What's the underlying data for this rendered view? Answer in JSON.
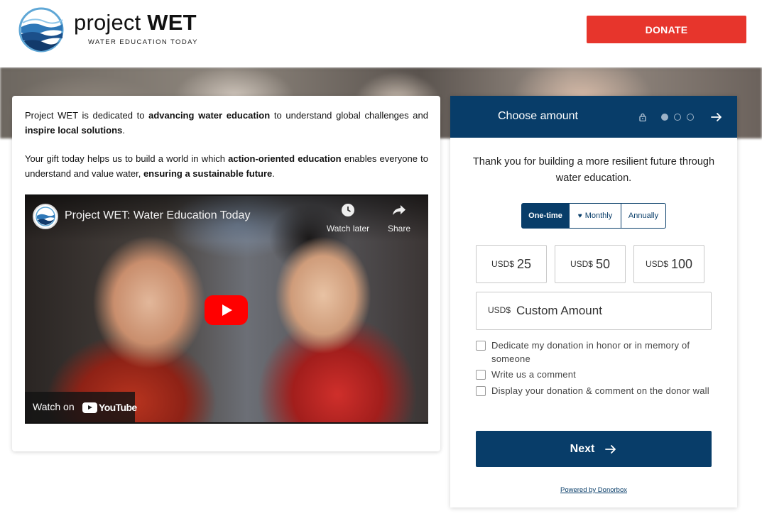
{
  "header": {
    "brand_light": "project",
    "brand_bold": "WET",
    "tagline": "WATER EDUCATION TODAY",
    "donate_label": "DONATE"
  },
  "info": {
    "p1": [
      {
        "text": "Project WET is dedicated to ",
        "bold": false
      },
      {
        "text": "advancing water education",
        "bold": true
      },
      {
        "text": " to understand global challenges and ",
        "bold": false
      },
      {
        "text": "inspire local solutions",
        "bold": true
      },
      {
        "text": ".",
        "bold": false
      }
    ],
    "p2": [
      {
        "text": "Your gift today helps us to build a world in which ",
        "bold": false
      },
      {
        "text": "action-oriented education",
        "bold": true
      },
      {
        "text": " enables everyone to understand and value water, ",
        "bold": false
      },
      {
        "text": "ensuring a sustainable future",
        "bold": true
      },
      {
        "text": ".",
        "bold": false
      }
    ]
  },
  "video": {
    "title": "Project WET: Water Education Today",
    "watch_later": "Watch later",
    "share": "Share",
    "watch_on": "Watch on",
    "youtube": "YouTube"
  },
  "donation": {
    "step_title": "Choose amount",
    "step_count": 3,
    "step_current": 1,
    "thanks": "Thank you for building a more resilient future through water education.",
    "frequencies": [
      "One-time",
      "Monthly",
      "Annually"
    ],
    "frequency_selected": "One-time",
    "currency": "USD$",
    "amounts": [
      "25",
      "50",
      "100"
    ],
    "custom_placeholder": "Custom Amount",
    "options": [
      "Dedicate my donation in honor or in memory of someone",
      "Write us a comment",
      "Display your donation & comment on the donor wall"
    ],
    "next_label": "Next",
    "powered_by": "Powered by Donorbox"
  },
  "colors": {
    "brand_navy": "#083d69",
    "donate_red": "#e7352c"
  }
}
